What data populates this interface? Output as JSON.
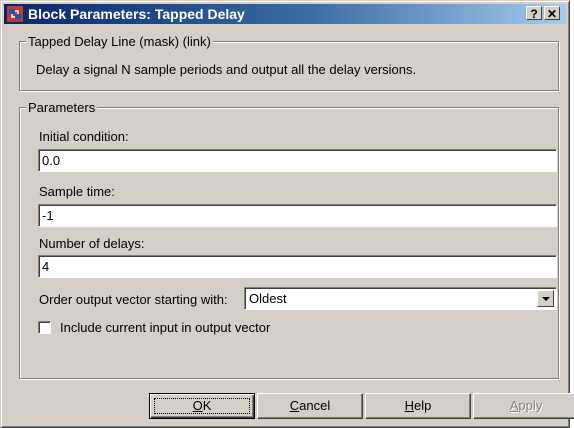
{
  "window": {
    "title": "Block Parameters: Tapped Delay",
    "help_glyph": "?",
    "close_glyph": "✕"
  },
  "description": {
    "group_title": "Tapped Delay Line (mask) (link)",
    "text": "Delay a signal N sample periods and output all the delay versions."
  },
  "parameters": {
    "group_title": "Parameters",
    "initial_condition": {
      "label": "Initial condition:",
      "value": "0.0"
    },
    "sample_time": {
      "label": "Sample time:",
      "value": "-1"
    },
    "number_of_delays": {
      "label": "Number of delays:",
      "value": "4"
    },
    "order_output": {
      "label": "Order output vector starting with:",
      "selected": "Oldest"
    },
    "include_current": {
      "label": "Include current input in output vector",
      "checked": false
    }
  },
  "buttons": {
    "ok": {
      "mnemonic": "O",
      "rest": "K"
    },
    "cancel": {
      "mnemonic": "C",
      "rest": "ancel"
    },
    "help": {
      "mnemonic": "H",
      "rest": "elp"
    },
    "apply": {
      "mnemonic": "A",
      "rest": "pply",
      "enabled": false
    }
  },
  "icons": {
    "app": "simulink-block-icon",
    "help": "question-icon",
    "close": "close-icon",
    "dropdown": "chevron-down-icon"
  },
  "colors": {
    "titlebar_start": "#0a246a",
    "titlebar_end": "#a6caf0",
    "face": "#d4d0c8"
  }
}
